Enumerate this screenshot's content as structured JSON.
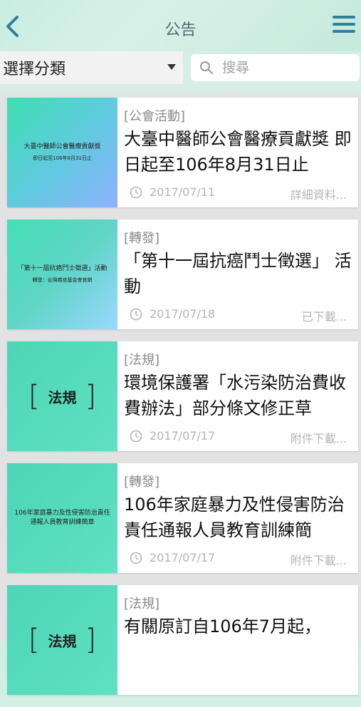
{
  "header": {
    "title": "公告"
  },
  "filter": {
    "category_label": "選擇分類",
    "search_placeholder": "搜尋"
  },
  "items": [
    {
      "thumb_line1": "大臺中醫師公會醫療貢獻獎",
      "thumb_line2": "即日起至106年8月31日止",
      "category": "[公會活動]",
      "headline": "大臺中醫師公會醫療貢獻獎 即日起至106年8月31日止",
      "date": "2017/07/11",
      "action": "詳細資料..."
    },
    {
      "thumb_line1": "「第十一屆抗癌鬥士徵選」活動",
      "thumb_line2": "轉發：台灣癌症基金會官網",
      "category": "[轉發]",
      "headline": "「第十一屆抗癌鬥士徵選」 活動",
      "date": "2017/07/18",
      "action": "已下載..."
    },
    {
      "thumb_big": "法規",
      "category": "[法規]",
      "headline": "環境保護署「水污染防治費收費辦法」部分條文修正草",
      "date": "2017/07/17",
      "action": "附件下載..."
    },
    {
      "thumb_line1": "106年家庭暴力及性侵害防治責任",
      "thumb_line2": "通報人員教育訓練簡章",
      "category": "[轉發]",
      "headline": "106年家庭暴力及性侵害防治責任通報人員教育訓練簡",
      "date": "2017/07/17",
      "action": "附件下載..."
    },
    {
      "thumb_big": "法規",
      "category": "[法規]",
      "headline": "有關原訂自106年7月起，",
      "date": "",
      "action": ""
    }
  ],
  "icons": {
    "back": "back-chevron-icon",
    "menu": "hamburger-menu-icon",
    "search": "search-icon",
    "clock": "clock-icon",
    "dropdown": "dropdown-caret-icon"
  },
  "colors": {
    "accent": "#2e7e9e",
    "meta_text": "#b5b5b5"
  }
}
